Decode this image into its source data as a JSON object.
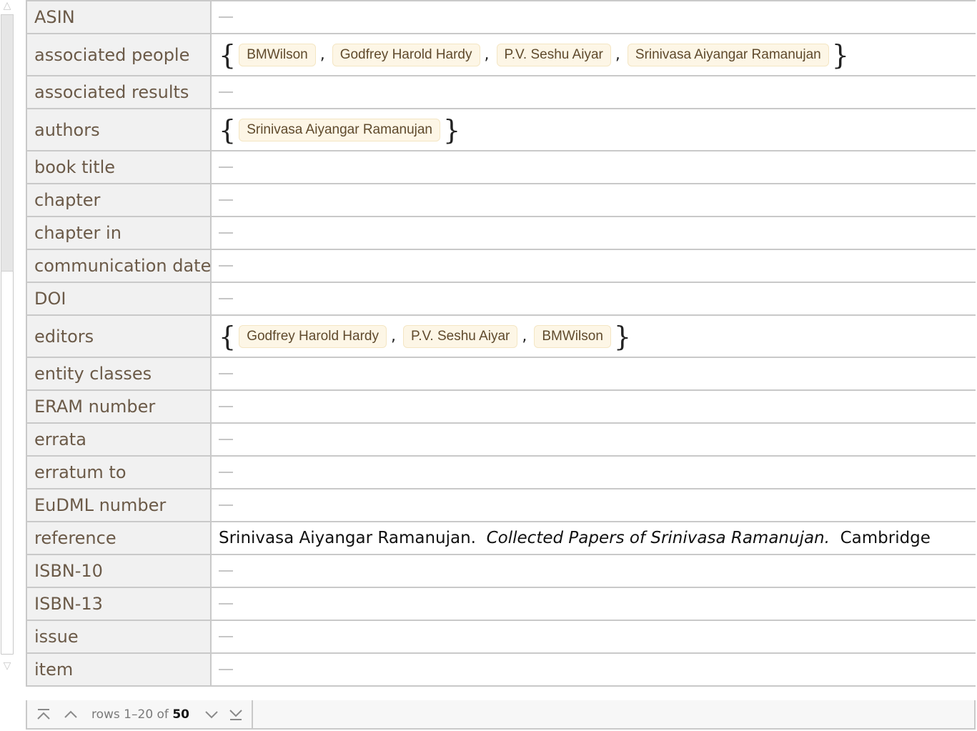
{
  "scrollbar": {
    "up_icon": "up-arrow",
    "down_icon": "down-arrow"
  },
  "rows": [
    {
      "key": "ASIN",
      "type": "missing"
    },
    {
      "key": "associated people",
      "type": "list",
      "items": [
        "BMWilson",
        "Godfrey Harold Hardy",
        "P.V. Seshu Aiyar",
        "Srinivasa Aiyangar Ramanujan"
      ]
    },
    {
      "key": "associated results",
      "type": "missing"
    },
    {
      "key": "authors",
      "type": "list",
      "items": [
        "Srinivasa Aiyangar Ramanujan"
      ]
    },
    {
      "key": "book title",
      "type": "missing"
    },
    {
      "key": "chapter",
      "type": "missing"
    },
    {
      "key": "chapter in",
      "type": "missing"
    },
    {
      "key": "communication date",
      "type": "missing"
    },
    {
      "key": "DOI",
      "type": "missing"
    },
    {
      "key": "editors",
      "type": "list",
      "items": [
        "Godfrey Harold Hardy",
        "P.V. Seshu Aiyar",
        "BMWilson"
      ]
    },
    {
      "key": "entity classes",
      "type": "missing"
    },
    {
      "key": "ERAM number",
      "type": "missing"
    },
    {
      "key": "errata",
      "type": "missing"
    },
    {
      "key": "erratum to",
      "type": "missing"
    },
    {
      "key": "EuDML number",
      "type": "missing"
    },
    {
      "key": "reference",
      "type": "reference",
      "author": "Srinivasa Aiyangar Ramanujan.",
      "title": "Collected Papers of Srinivasa Ramanujan.",
      "rest": "Cambridge"
    },
    {
      "key": "ISBN-10",
      "type": "missing"
    },
    {
      "key": "ISBN-13",
      "type": "missing"
    },
    {
      "key": "issue",
      "type": "missing"
    },
    {
      "key": "item",
      "type": "missing"
    }
  ],
  "footer": {
    "rows_label": "rows 1–20 of",
    "total": "50",
    "icons": [
      "first-page-icon",
      "previous-page-icon",
      "next-page-icon",
      "last-page-icon"
    ]
  }
}
